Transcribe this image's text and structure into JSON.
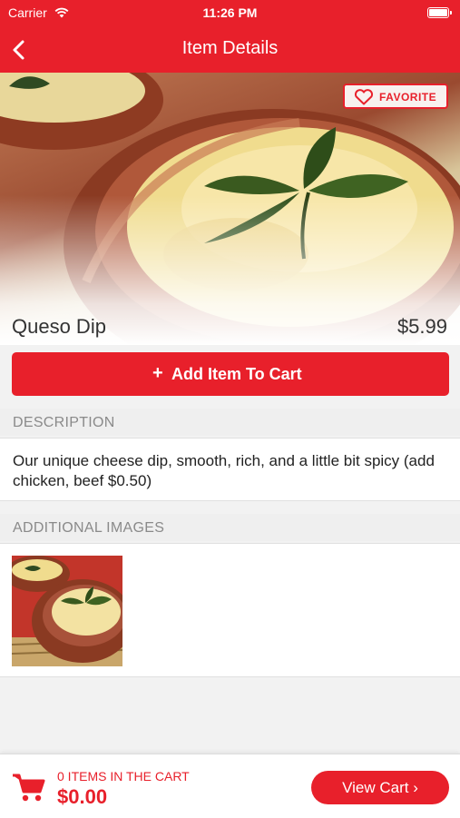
{
  "status_bar": {
    "carrier": "Carrier",
    "time": "11:26 PM"
  },
  "nav": {
    "title": "Item Details",
    "back_icon": "chevron-left-icon"
  },
  "item": {
    "name": "Queso Dip",
    "price": "$5.99",
    "favorite_label": "FAVORITE",
    "add_to_cart_label": "Add Item To Cart",
    "add_icon": "+"
  },
  "description": {
    "header": "DESCRIPTION",
    "text": "Our unique cheese dip, smooth, rich, and a little bit spicy (add chicken, beef $0.50)"
  },
  "additional_images": {
    "header": "ADDITIONAL IMAGES"
  },
  "cart": {
    "items_label": "0 ITEMS IN THE CART",
    "total": "$0.00",
    "view_cart_label": "View Cart ›"
  },
  "colors": {
    "accent": "#e8202b",
    "section_bg": "#efefef",
    "header_text": "#8a8a8a"
  }
}
